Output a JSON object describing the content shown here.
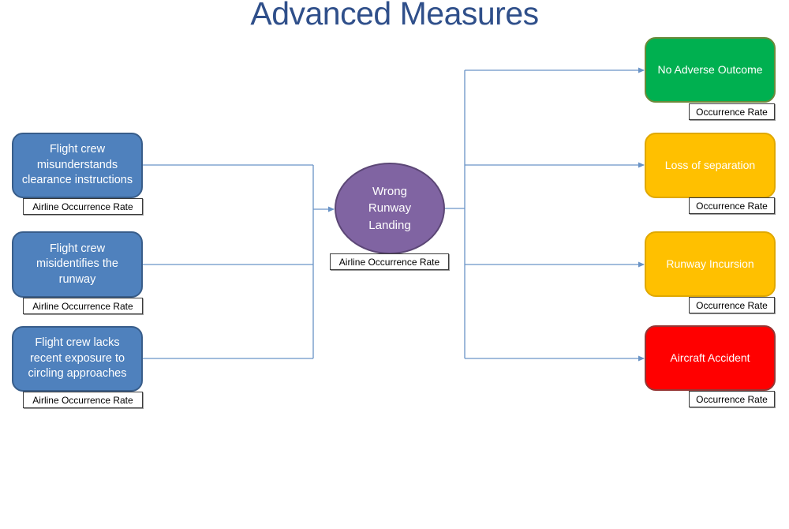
{
  "title": "Advanced Measures",
  "center_event": {
    "label": "Wrong Runway Landing",
    "lines": [
      "Wrong",
      "Runway",
      "Landing"
    ],
    "tag": "Airline Occurrence Rate",
    "color": "#8064a2"
  },
  "causes": [
    {
      "label": "Flight crew misunderstands clearance instructions",
      "tag": "Airline Occurrence Rate"
    },
    {
      "label": "Flight crew misidentifies the runway",
      "tag": "Airline Occurrence Rate"
    },
    {
      "label": "Flight crew lacks recent exposure to circling approaches",
      "tag": "Airline Occurrence Rate"
    }
  ],
  "outcomes": [
    {
      "label": "No Adverse Outcome",
      "tag": "Occurrence Rate",
      "color": "#00b050",
      "border": "#6b8a3a"
    },
    {
      "label": "Loss of separation",
      "tag": "Occurrence Rate",
      "color": "#ffc000",
      "border": "#e0a800"
    },
    {
      "label": "Runway Incursion",
      "tag": "Occurrence Rate",
      "color": "#ffc000",
      "border": "#e0a800"
    },
    {
      "label": "Aircraft Accident",
      "tag": "Occurrence Rate",
      "color": "#ff0000",
      "border": "#953735"
    }
  ],
  "colors": {
    "cause_fill": "#4f81bd",
    "connector": "#4f81bd",
    "title": "#2f4f8a"
  }
}
